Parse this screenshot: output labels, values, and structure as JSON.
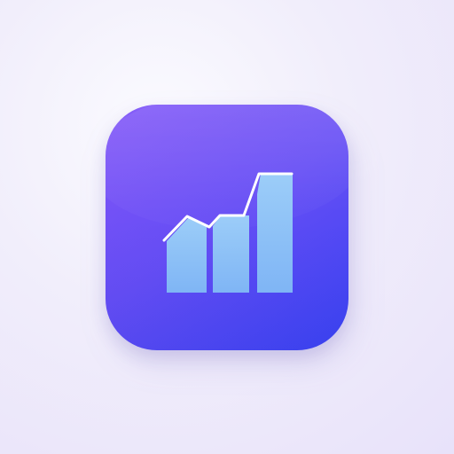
{
  "app_icon": {
    "icon_name": "bar-chart-icon",
    "colors": {
      "background_start": "#8155f8",
      "background_end": "#3b43f3",
      "bars": "#8ec4f8",
      "line": "#ffffff"
    }
  }
}
